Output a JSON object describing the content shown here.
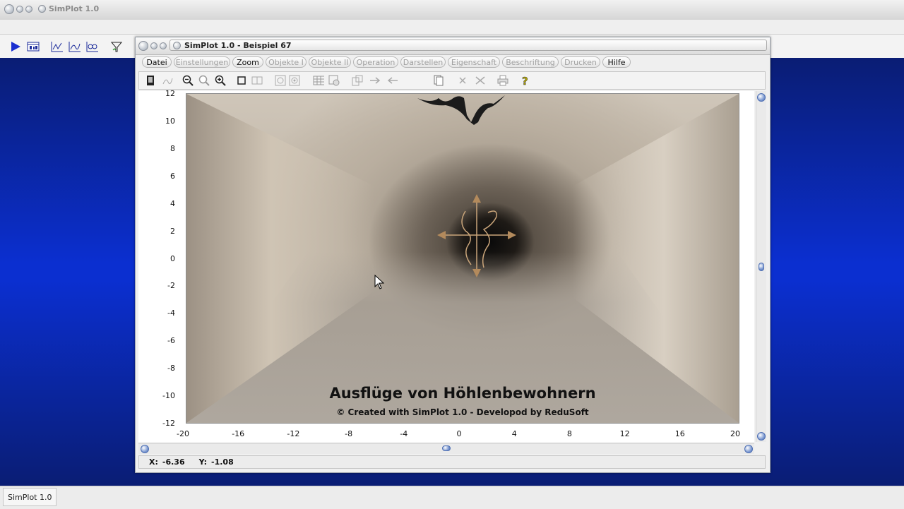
{
  "app": {
    "title": "SimPlot 1.0",
    "taskbar_label": "SimPlot 1.0"
  },
  "document": {
    "title": "SimPlot 1.0 - Beispiel 67",
    "menu": [
      {
        "label": "Datei",
        "enabled": true
      },
      {
        "label": "Einstellungen",
        "enabled": false
      },
      {
        "label": "Zoom",
        "enabled": true
      },
      {
        "label": "Objekte I",
        "enabled": false
      },
      {
        "label": "Objekte II",
        "enabled": false
      },
      {
        "label": "Operation",
        "enabled": false
      },
      {
        "label": "Darstellen",
        "enabled": false
      },
      {
        "label": "Eigenschaft",
        "enabled": false
      },
      {
        "label": "Beschriftung",
        "enabled": false
      },
      {
        "label": "Drucken",
        "enabled": false
      },
      {
        "label": "Hilfe",
        "enabled": true
      }
    ]
  },
  "chart_data": {
    "type": "scatter",
    "title": "Ausflüge von Höhlenbewohnern",
    "subtitle": "© Created with SimPlot 1.0 - Developod by ReduSoft",
    "xlim": [
      -20,
      20
    ],
    "ylim": [
      -12,
      12
    ],
    "x_ticks": [
      "-20",
      "-16",
      "-12",
      "-8",
      "-4",
      "0",
      "4",
      "8",
      "12",
      "16",
      "20"
    ],
    "y_ticks": [
      "12",
      "10",
      "8",
      "6",
      "4",
      "2",
      "0",
      "-2",
      "-4",
      "-6",
      "-8",
      "-10",
      "-12"
    ],
    "grid": false
  },
  "status": {
    "x_label": "X:",
    "x_value": "-6.36",
    "y_label": "Y:",
    "y_value": "-1.08"
  },
  "colors": {
    "desktop": "#0b2fd0",
    "accent_blue": "#4e6fb3"
  }
}
